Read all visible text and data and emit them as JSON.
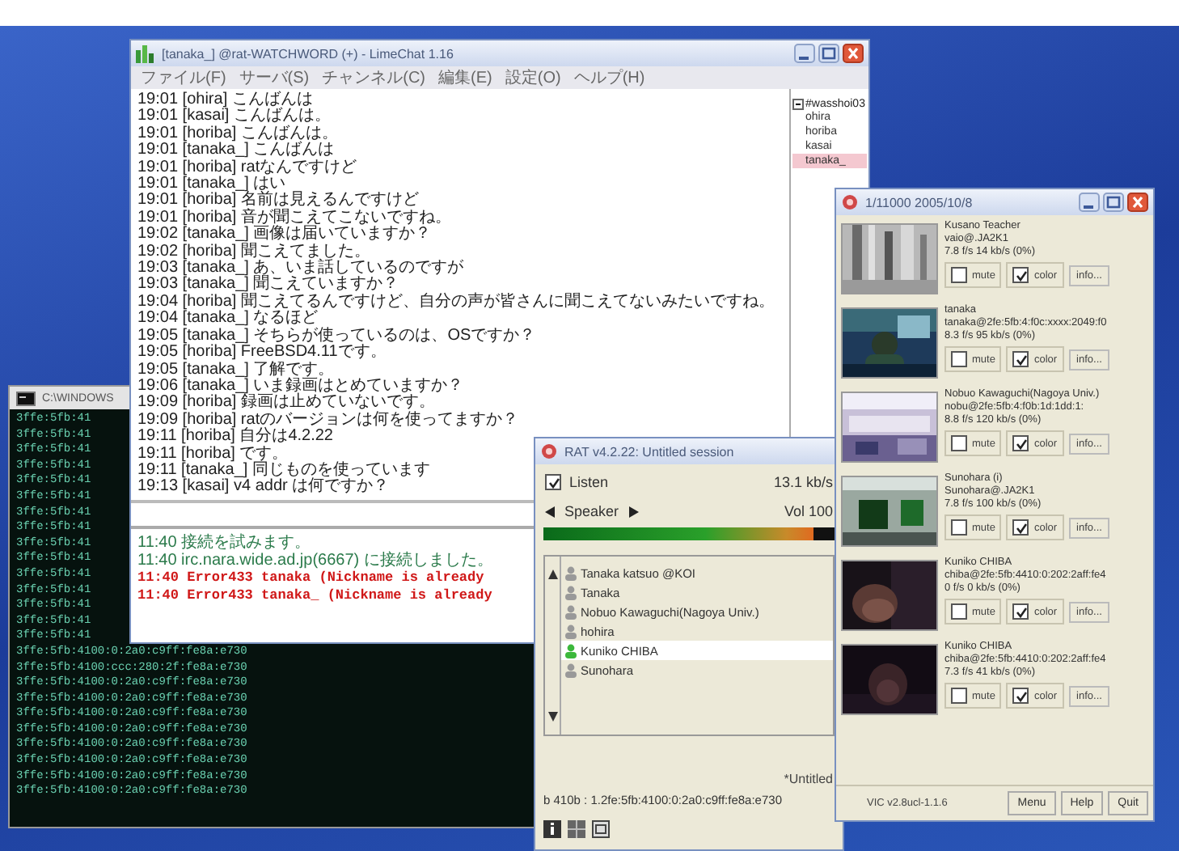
{
  "console_window": {
    "title": "C:\\WINDOWS",
    "lines": [
      "3ffe:5fb:41",
      "3ffe:5fb:41",
      "3ffe:5fb:41",
      "3ffe:5fb:41",
      "3ffe:5fb:41",
      "3ffe:5fb:41",
      "3ffe:5fb:41",
      "3ffe:5fb:41",
      "3ffe:5fb:41",
      "3ffe:5fb:41",
      "3ffe:5fb:41",
      "3ffe:5fb:41",
      "3ffe:5fb:41",
      "3ffe:5fb:41",
      "3ffe:5fb:41",
      "3ffe:5fb:4100:0:2a0:c9ff:fe8a:e730",
      "3ffe:5fb:4100:ccc:280:2f:fe8a:e730",
      "3ffe:5fb:4100:0:2a0:c9ff:fe8a:e730",
      "3ffe:5fb:4100:0:2a0:c9ff:fe8a:e730",
      "3ffe:5fb:4100:0:2a0:c9ff:fe8a:e730",
      "3ffe:5fb:4100:0:2a0:c9ff:fe8a:e730",
      "3ffe:5fb:4100:0:2a0:c9ff:fe8a:e730",
      "3ffe:5fb:4100:0:2a0:c9ff:fe8a:e730",
      "3ffe:5fb:4100:0:2a0:c9ff:fe8a:e730",
      "3ffe:5fb:4100:0:2a0:c9ff:fe8a:e730"
    ]
  },
  "chat_window": {
    "title": "[tanaka_] @rat-WATCHWORD (+) - LimeChat 1.16",
    "menu": [
      "ファイル(F)",
      "サーバ(S)",
      "チャンネル(C)",
      "編集(E)",
      "設定(O)",
      "ヘルプ(H)"
    ],
    "log": [
      "19:01 [ohira] こんばんは",
      "19:01 [kasai] こんばんは。",
      "19:01 [horiba] こんばんは。",
      "19:01 [tanaka_] こんばんは",
      "19:01 [horiba] ratなんですけど",
      "19:01 [tanaka_] はい",
      "19:01 [horiba] 名前は見えるんですけど",
      "19:01 [horiba] 音が聞こえてこないですね。",
      "19:02 [tanaka_] 画像は届いていますか？",
      "19:02 [horiba] 聞こえてました。",
      "19:03 [tanaka_] あ、いま話しているのですが",
      "19:03 [tanaka_] 聞こえていますか？",
      "19:04 [horiba] 聞こえてるんですけど、自分の声が皆さんに聞こえてないみたいですね。",
      "19:04 [tanaka_] なるほど",
      "19:05 [tanaka_] そちらが使っているのは、OSですか？",
      "19:05 [horiba] FreeBSD4.11です。",
      "19:05 [tanaka_] 了解です。",
      "19:06 [tanaka_] いま録画はとめていますか？",
      "19:09 [horiba] 録画は止めていないです。",
      "19:09 [horiba] ratのバージョンは何を使ってますか？",
      "19:11 [horiba] 自分は4.2.22",
      "19:11 [horiba] です。",
      "19:11 [tanaka_] 同じものを使っています",
      "19:13 [kasai] v4 addr は何ですか？"
    ],
    "members": {
      "channel": "#wasshoi03",
      "items": [
        {
          "name": "ohira",
          "selected": false
        },
        {
          "name": "horiba",
          "selected": false
        },
        {
          "name": "kasai",
          "selected": false
        },
        {
          "name": "tanaka_",
          "selected": true
        }
      ]
    },
    "system_log": [
      {
        "kind": "info",
        "text": "11:40 接続を試みます。"
      },
      {
        "kind": "info",
        "text": "11:40 irc.nara.wide.ad.jp(6667) に接続しました。"
      },
      {
        "kind": "error",
        "text": "11:40 Error433 tanaka (Nickname is already"
      },
      {
        "kind": "error",
        "text": "11:40 Error433 tanaka_ (Nickname is already"
      }
    ]
  },
  "rat_window": {
    "title": "RAT v4.2.22: Untitled session",
    "listen": {
      "label": "Listen",
      "checked": true,
      "rate": "13.1 kb/s"
    },
    "speaker": {
      "label": "Speaker",
      "volume": "Vol 100",
      "level": 0.93
    },
    "participants": [
      {
        "name": "Tanaka katsuo @KOI",
        "selected": false
      },
      {
        "name": "Tanaka",
        "selected": false
      },
      {
        "name": "Nobuo Kawaguchi(Nagoya Univ.)",
        "selected": false
      },
      {
        "name": "hohira",
        "selected": false
      },
      {
        "name": "Kuniko CHIBA",
        "selected": true
      },
      {
        "name": "Sunohara",
        "selected": false
      }
    ],
    "session": "*Untitled",
    "address": "b 410b : 1.2fe:5fb:4100:0:2a0:c9ff:fe8a:e730"
  },
  "vic_window": {
    "title": "1/11000   2005/10/8",
    "streams": [
      {
        "kind": "picture",
        "name": "Kusano Teacher",
        "address": "vaio@.JA2K1",
        "stats": "7.8 f/s   14 kb/s   (0%)",
        "mute_label": "mute",
        "mute": false,
        "color_label": "color",
        "color": true,
        "info_button": "info..."
      },
      {
        "kind": "picture",
        "name": "tanaka",
        "address": "tanaka@2fe:5fb:4:f0c:xxxx:2049:f0",
        "stats": "8.3 f/s   95 kb/s   (0%)",
        "mute_label": "mute",
        "mute": false,
        "color_label": "color",
        "color": true,
        "info_button": "info..."
      },
      {
        "kind": "picture",
        "name": "Nobuo Kawaguchi(Nagoya Univ.)",
        "address": "nobu@2fe:5fb:4:f0b:1d:1dd:1:",
        "stats": "8.8 f/s   120 kb/s   (0%)",
        "mute_label": "mute",
        "mute": false,
        "color_label": "color",
        "color": true,
        "info_button": "info..."
      },
      {
        "kind": "picture",
        "name": "Sunohara (i)",
        "address": "Sunohara@.JA2K1",
        "stats": "7.8 f/s   100 kb/s   (0%)",
        "mute_label": "mute",
        "mute": false,
        "color_label": "color",
        "color": true,
        "info_button": "info..."
      },
      {
        "kind": "picture",
        "name": "Kuniko CHIBA",
        "address": "chiba@2fe:5fb:4410:0:202:2aff:fe4",
        "stats": "0 f/s   0 kb/s   (0%)",
        "mute_label": "mute",
        "mute": false,
        "color_label": "color",
        "color": true,
        "info_button": "info..."
      },
      {
        "kind": "picture",
        "name": "Kuniko CHIBA",
        "address": "chiba@2fe:5fb:4410:0:202:2aff:fe4",
        "stats": "7.3 f/s   41 kb/s   (0%)",
        "mute_label": "mute",
        "mute": false,
        "color_label": "color",
        "color": true,
        "info_button": "info..."
      }
    ],
    "version": "VIC v2.8ucl-1.1.6",
    "buttons": [
      "Menu",
      "Help",
      "Quit"
    ]
  }
}
